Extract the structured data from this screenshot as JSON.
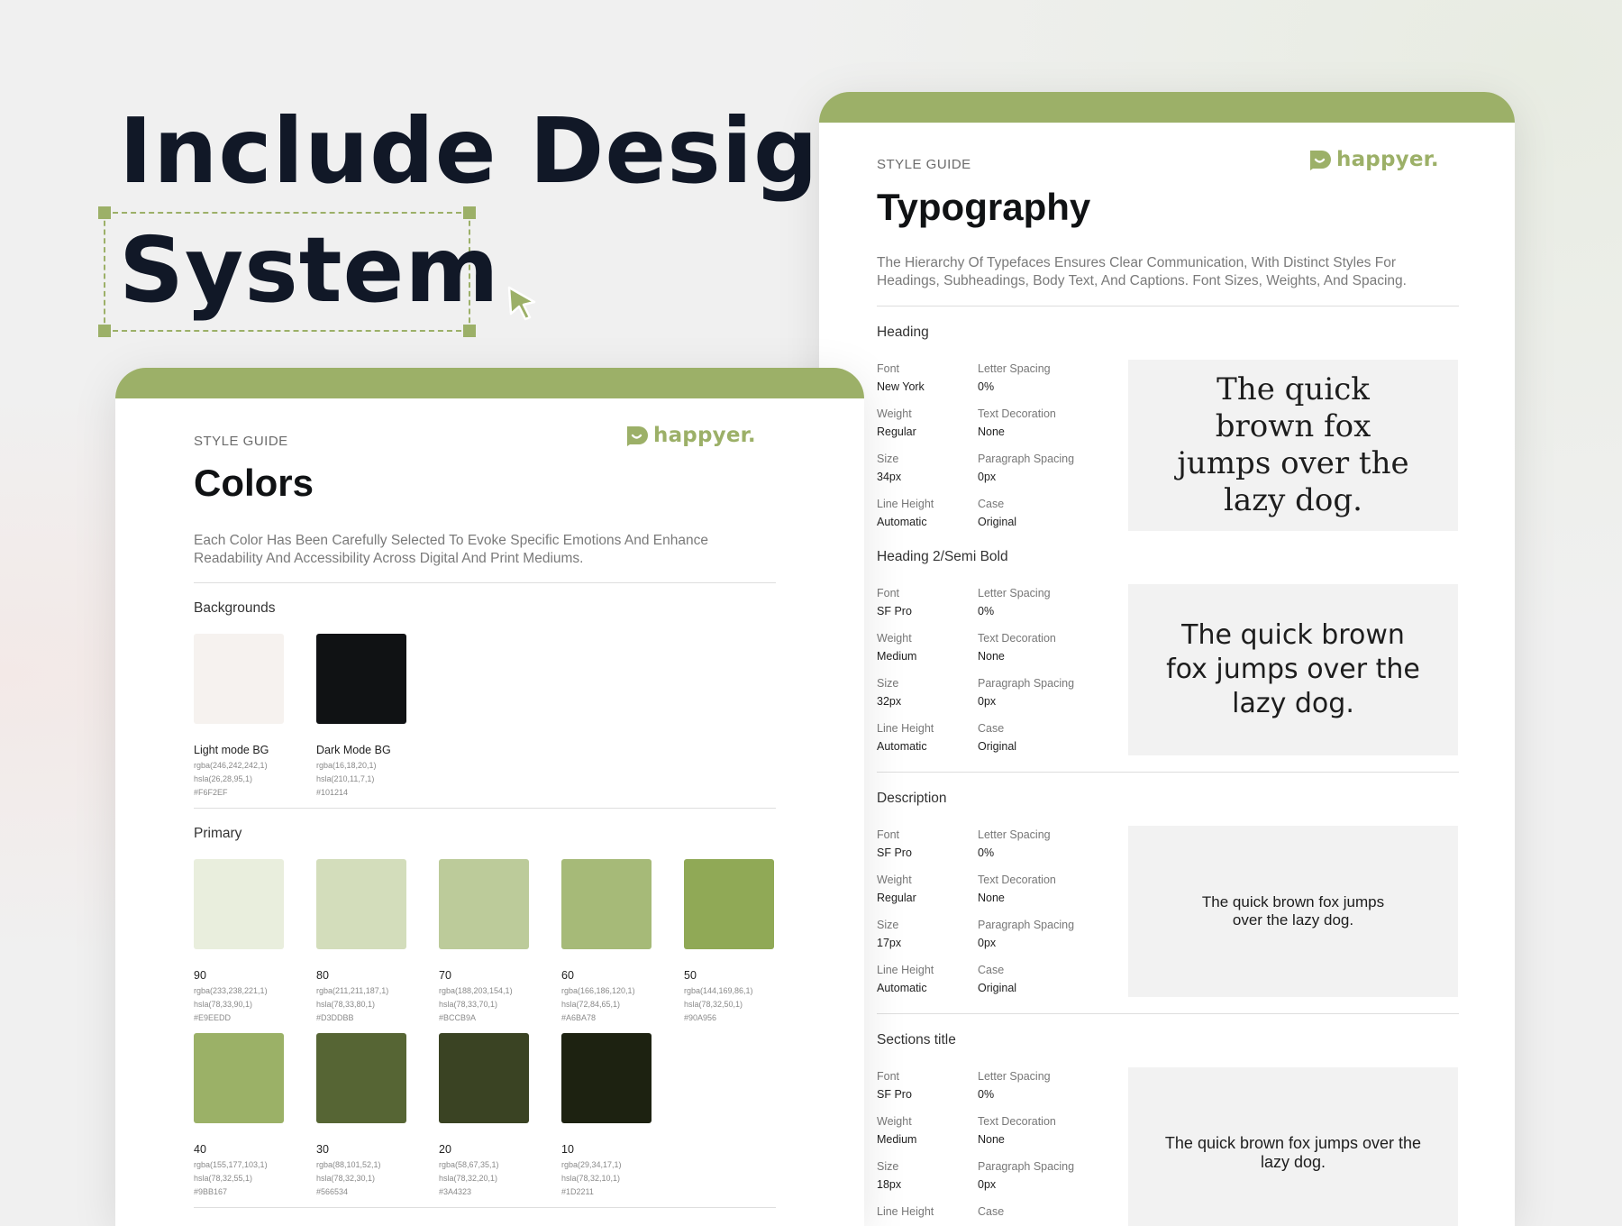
{
  "hero": {
    "line1": "Include Design",
    "line2": "System"
  },
  "brand": {
    "logo_text": "happyer.",
    "accent": "#9cb068"
  },
  "typography_card": {
    "eyebrow": "STYLE GUIDE",
    "title": "Typography",
    "description": "The Hierarchy Of Typefaces Ensures Clear Communication, With Distinct Styles For Headings, Subheadings, Body Text, And Captions. Font Sizes, Weights, And Spacing.",
    "sections": [
      {
        "title": "Heading",
        "props": {
          "font_label": "Font",
          "font": "New York",
          "weight_label": "Weight",
          "weight": "Regular",
          "size_label": "Size",
          "size": "34px",
          "lh_label": "Line Height",
          "lh": "Automatic",
          "ls_label": "Letter Spacing",
          "ls": "0%",
          "td_label": "Text Decoration",
          "td": "None",
          "ps_label": "Paragraph Spacing",
          "ps": "0px",
          "case_label": "Case",
          "case": "Original"
        },
        "sample": "The quick brown fox jumps over the lazy dog."
      },
      {
        "title": "Heading 2/Semi Bold",
        "props": {
          "font_label": "Font",
          "font": "SF Pro",
          "weight_label": "Weight",
          "weight": "Medium",
          "size_label": "Size",
          "size": "32px",
          "lh_label": "Line Height",
          "lh": "Automatic",
          "ls_label": "Letter Spacing",
          "ls": "0%",
          "td_label": "Text Decoration",
          "td": "None",
          "ps_label": "Paragraph Spacing",
          "ps": "0px",
          "case_label": "Case",
          "case": "Original"
        },
        "sample": "The quick brown fox jumps over the lazy dog."
      },
      {
        "title": "Description",
        "props": {
          "font_label": "Font",
          "font": "SF Pro",
          "weight_label": "Weight",
          "weight": "Regular",
          "size_label": "Size",
          "size": "17px",
          "lh_label": "Line Height",
          "lh": "Automatic",
          "ls_label": "Letter Spacing",
          "ls": "0%",
          "td_label": "Text Decoration",
          "td": "None",
          "ps_label": "Paragraph Spacing",
          "ps": "0px",
          "case_label": "Case",
          "case": "Original"
        },
        "sample": "The quick brown fox jumps over the lazy dog."
      },
      {
        "title": "Sections title",
        "props": {
          "font_label": "Font",
          "font": "SF Pro",
          "weight_label": "Weight",
          "weight": "Medium",
          "size_label": "Size",
          "size": "18px",
          "lh_label": "Line Height",
          "lh": "",
          "ls_label": "Letter Spacing",
          "ls": "0%",
          "td_label": "Text Decoration",
          "td": "None",
          "ps_label": "Paragraph Spacing",
          "ps": "0px",
          "case_label": "Case",
          "case": ""
        },
        "sample": "The quick brown fox jumps over the lazy dog."
      }
    ]
  },
  "colors_card": {
    "eyebrow": "STYLE GUIDE",
    "title": "Colors",
    "description": "Each Color Has Been Carefully Selected To Evoke Specific Emotions And Enhance Readability And Accessibility Across Digital And Print Mediums.",
    "backgrounds_title": "Backgrounds",
    "backgrounds": [
      {
        "name": "Light mode BG",
        "rgba": "rgba(246,242,242,1)",
        "hsla": "hsla(26,28,95,1)",
        "hex": "#F6F2EF",
        "color": "#F6F2EF"
      },
      {
        "name": "Dark Mode BG",
        "rgba": "rgba(16,18,20,1)",
        "hsla": "hsla(210,11,7,1)",
        "hex": "#101214",
        "color": "#101214"
      }
    ],
    "primary_title": "Primary",
    "primary": [
      {
        "name": "90",
        "rgba": "rgba(233,238,221,1)",
        "hsla": "hsla(78,33,90,1)",
        "hex": "#E9EEDD",
        "color": "#E9EEDD"
      },
      {
        "name": "80",
        "rgba": "rgba(211,211,187,1)",
        "hsla": "hsla(78,33,80,1)",
        "hex": "#D3DDBB",
        "color": "#D3DDBB"
      },
      {
        "name": "70",
        "rgba": "rgba(188,203,154,1)",
        "hsla": "hsla(78,33,70,1)",
        "hex": "#BCCB9A",
        "color": "#BCCB9A"
      },
      {
        "name": "60",
        "rgba": "rgba(166,186,120,1)",
        "hsla": "hsla(72,84,65,1)",
        "hex": "#A6BA78",
        "color": "#A6BA78"
      },
      {
        "name": "50",
        "rgba": "rgba(144,169,86,1)",
        "hsla": "hsla(78,32,50,1)",
        "hex": "#90A956",
        "color": "#90A956"
      },
      {
        "name": "40",
        "rgba": "rgba(155,177,103,1)",
        "hsla": "hsla(78,32,55,1)",
        "hex": "#9BB167",
        "color": "#9BB167"
      },
      {
        "name": "30",
        "rgba": "rgba(88,101,52,1)",
        "hsla": "hsla(78,32,30,1)",
        "hex": "#566534",
        "color": "#566534"
      },
      {
        "name": "20",
        "rgba": "rgba(58,67,35,1)",
        "hsla": "hsla(78,32,20,1)",
        "hex": "#3A4323",
        "color": "#3A4323"
      },
      {
        "name": "10",
        "rgba": "rgba(29,34,17,1)",
        "hsla": "hsla(78,32,10,1)",
        "hex": "#1D2211",
        "color": "#1D2211"
      }
    ]
  }
}
